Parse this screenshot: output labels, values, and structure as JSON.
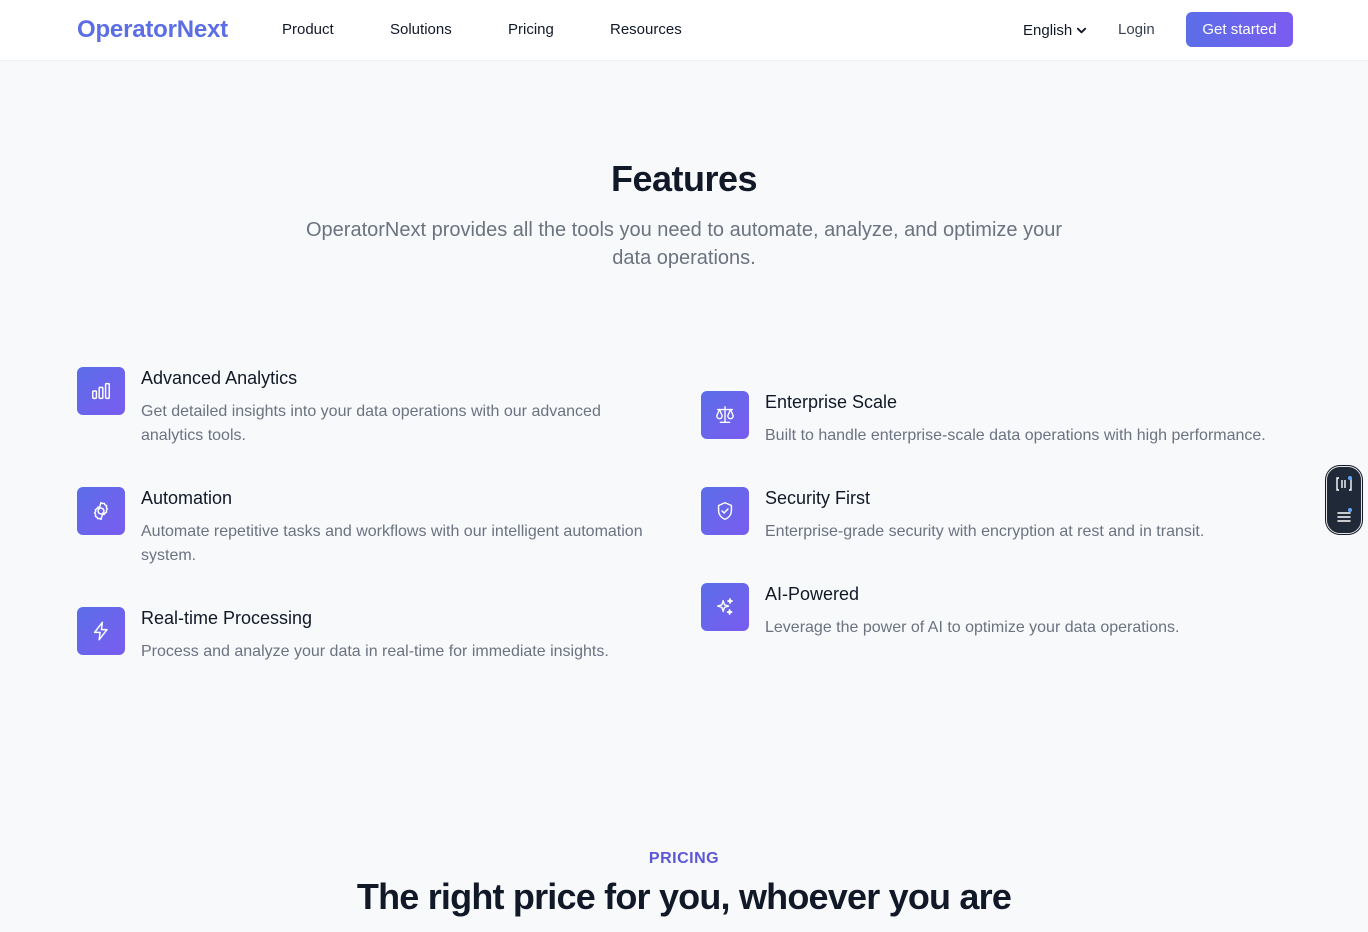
{
  "header": {
    "logo": "OperatorNext",
    "nav": [
      "Product",
      "Solutions",
      "Pricing",
      "Resources"
    ],
    "language": "English",
    "login": "Login",
    "cta": "Get started"
  },
  "features": {
    "title": "Features",
    "subtitle": "OperatorNext provides all the tools you need to automate, analyze, and optimize your data operations.",
    "items": [
      {
        "title": "Advanced Analytics",
        "description": "Get detailed insights into your data operations with our advanced analytics tools.",
        "icon": "bar-chart-icon"
      },
      {
        "title": "Automation",
        "description": "Automate repetitive tasks and workflows with our intelligent automation system.",
        "icon": "gear-icon"
      },
      {
        "title": "Real-time Processing",
        "description": "Process and analyze your data in real-time for immediate insights.",
        "icon": "lightning-icon"
      },
      {
        "title": "Enterprise Scale",
        "description": "Built to handle enterprise-scale data operations with high performance.",
        "icon": "scale-icon"
      },
      {
        "title": "Security First",
        "description": "Enterprise-grade security with encryption at rest and in transit.",
        "icon": "shield-check-icon"
      },
      {
        "title": "AI-Powered",
        "description": "Leverage the power of AI to optimize your data operations.",
        "icon": "sparkles-icon"
      }
    ]
  },
  "pricing": {
    "eyebrow": "PRICING",
    "title": "The right price for you, whoever you are"
  },
  "colors": {
    "brand": "#5b6ee6",
    "accent_gradient_start": "#5b6ee8",
    "accent_gradient_end": "#7a5cf0",
    "eyebrow": "#5b57d6"
  }
}
